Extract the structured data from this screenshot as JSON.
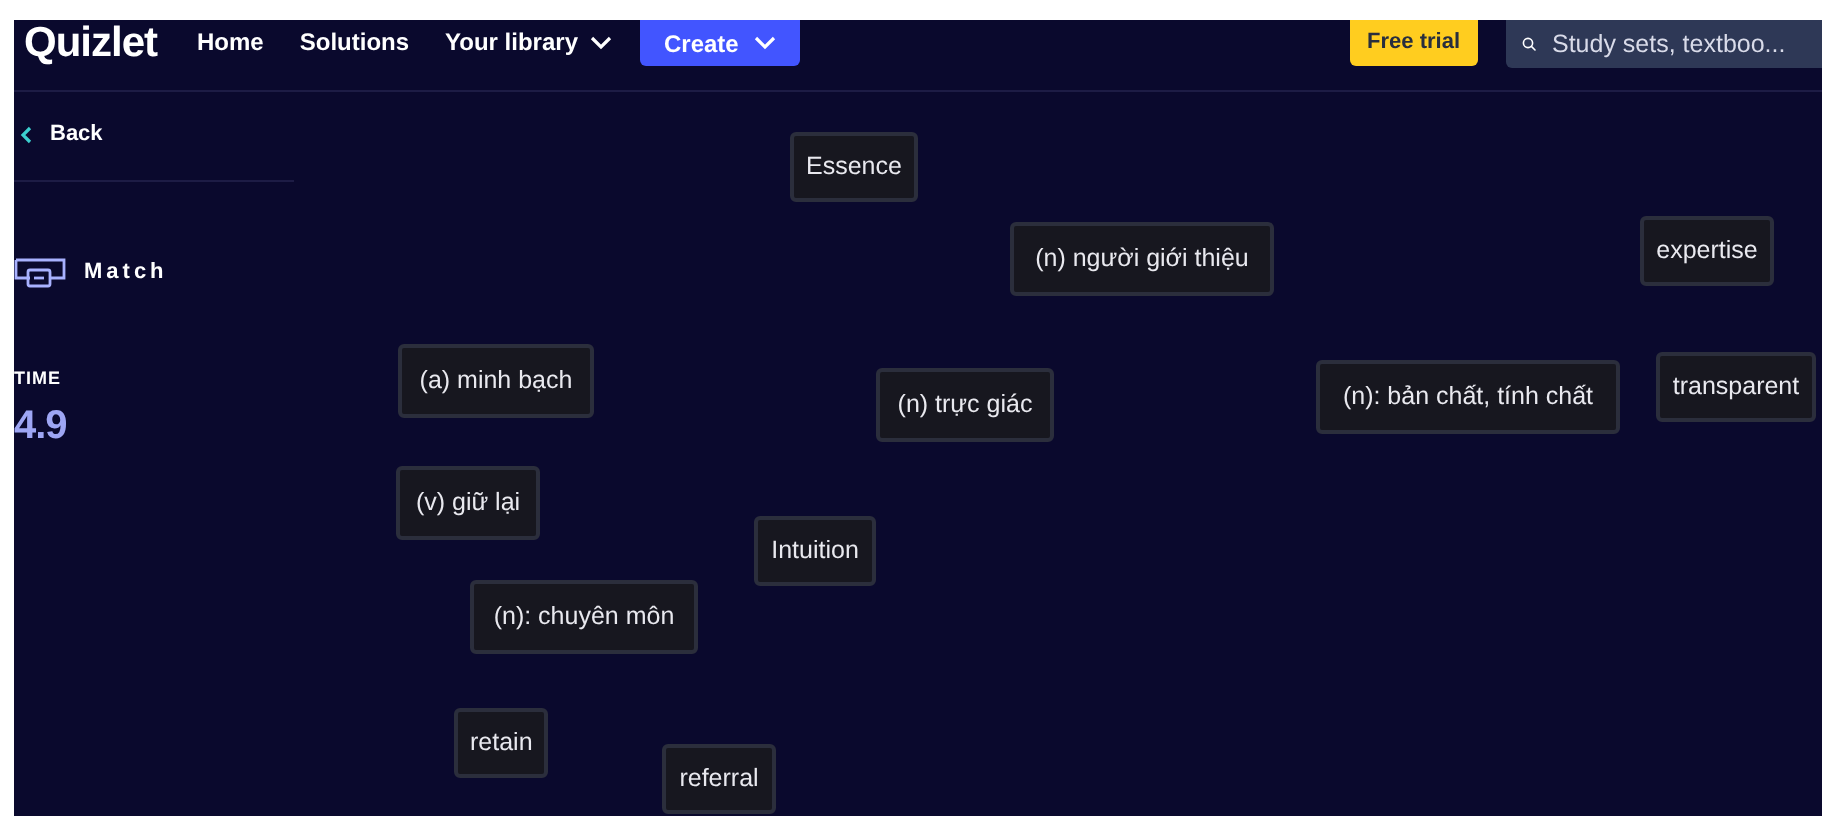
{
  "nav": {
    "logo": "Quizlet",
    "links": [
      {
        "label": "Home",
        "kind": "link"
      },
      {
        "label": "Solutions",
        "kind": "link"
      },
      {
        "label": "Your library",
        "kind": "dropdown"
      }
    ],
    "create_button": "Create",
    "free_trial_button": "Free trial",
    "search": {
      "placeholder": "Study sets, textboo..."
    }
  },
  "sidebar": {
    "back": "Back",
    "mode": "Match",
    "time_label": "TIME",
    "time_value": "4.9"
  },
  "tiles": [
    {
      "label": "Essence"
    },
    {
      "label": "(n) người giới thiệu"
    },
    {
      "label": "expertise"
    },
    {
      "label": "(a) minh bạch"
    },
    {
      "label": "(n) trực giác"
    },
    {
      "label": "(n): bản chất, tính chất"
    },
    {
      "label": "transparent"
    },
    {
      "label": "(v) giữ lại"
    },
    {
      "label": "Intuition"
    },
    {
      "label": "(n): chuyên môn"
    },
    {
      "label": "retain"
    },
    {
      "label": "referral"
    }
  ]
}
